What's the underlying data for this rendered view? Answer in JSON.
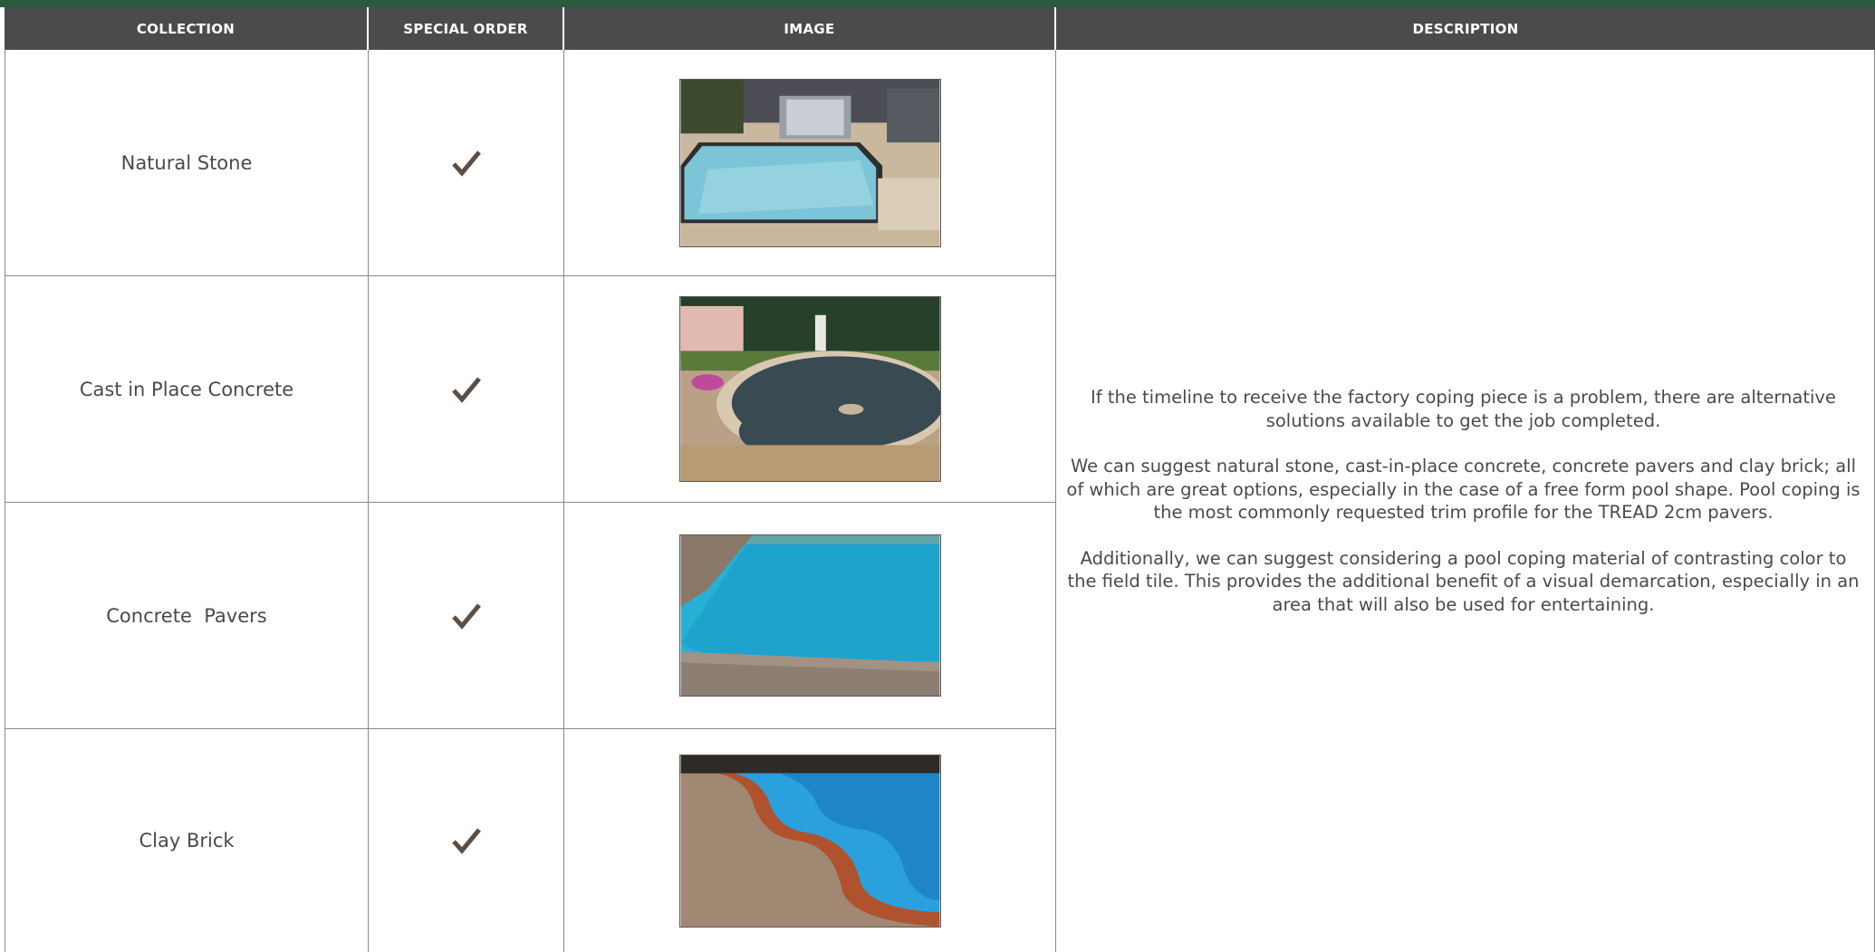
{
  "header": {
    "collection": "COLLECTION",
    "special_order": "SPECIAL ORDER",
    "image": "IMAGE",
    "description": "DESCRIPTION"
  },
  "rows": [
    {
      "collection": "Natural Stone",
      "special_order": true,
      "image_icon": "pool-photo-natural-stone"
    },
    {
      "collection": "Cast in Place Concrete",
      "special_order": true,
      "image_icon": "pool-photo-cast-concrete"
    },
    {
      "collection": "Concrete  Pavers",
      "special_order": true,
      "image_icon": "pool-photo-concrete-pavers"
    },
    {
      "collection": "Clay Brick",
      "special_order": true,
      "image_icon": "pool-photo-clay-brick"
    }
  ],
  "description": {
    "p1": "If the timeline to receive the factory coping piece is a problem, there are alternative solutions available to get the job completed.",
    "p2": "We can suggest natural stone, cast-in-place concrete, concrete pavers and clay brick; all of which are great options, especially in the case of a free form pool shape. Pool coping is the most commonly requested trim profile for the TREAD 2cm pavers.",
    "p3": "Additionally, we can suggest considering a pool coping material of contrasting color to the field tile. This provides the additional benefit of a visual demarcation, especially in an area that will also be used for entertaining."
  },
  "colors": {
    "header_bg": "#4a4b4d",
    "top_bar": "#2d5a3d",
    "check": "#5b4f45"
  }
}
